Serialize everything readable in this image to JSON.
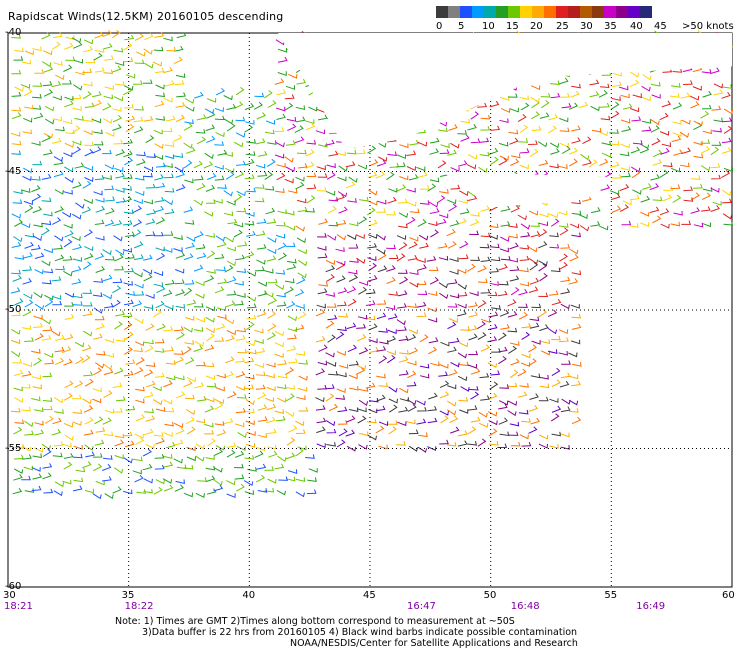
{
  "title": "Rapidscat Winds(12.5KM) 20160105 descending",
  "legend": {
    "colors": [
      "#3c3c3c",
      "#808080",
      "#1e50ff",
      "#009bff",
      "#00aaaa",
      "#23a023",
      "#6cc800",
      "#ffd200",
      "#ffaa00",
      "#ff6f00",
      "#e02020",
      "#b41e1e",
      "#b45a00",
      "#8b3a0f",
      "#c800c8",
      "#8b008b",
      "#6400c8",
      "#282878"
    ],
    "labels": [
      "0",
      "5",
      "10",
      "15",
      "20",
      "25",
      "30",
      "35",
      "40",
      "45",
      ">50 knots"
    ]
  },
  "axes": {
    "lon_ticks": [
      "30",
      "35",
      "40",
      "45",
      "50",
      "55",
      "60"
    ],
    "lat_ticks": [
      "-40",
      "-45",
      "-50",
      "-55",
      "-60"
    ],
    "time_labels": [
      {
        "lon": 30,
        "text": "18:21"
      },
      {
        "lon": 35,
        "text": "18:22"
      },
      {
        "lon": 46.7,
        "text": "16:47"
      },
      {
        "lon": 51,
        "text": "16:48"
      },
      {
        "lon": 56.2,
        "text": "16:49"
      }
    ]
  },
  "notes": [
    "Note: 1) Times are GMT 2)Times along bottom correspond to measurement at ~50S",
    "3)Data buffer is 22 hrs from 20160105 4) Black wind barbs indicate possible contamination",
    "NOAA/NESDIS/Center for Satellite Applications and Research"
  ],
  "wind_regions": [
    {
      "region": "west-north",
      "lon": [
        30,
        37
      ],
      "lat": [
        -40,
        -44
      ],
      "colors": [
        "#ffd200",
        "#ffaa00",
        "#6cc800",
        "#23a023"
      ]
    },
    {
      "region": "west-mid",
      "lon": [
        30,
        37
      ],
      "lat": [
        -44,
        -50
      ],
      "colors": [
        "#1e50ff",
        "#009bff",
        "#00aaaa",
        "#23a023"
      ]
    },
    {
      "region": "center-west",
      "lon": [
        37,
        42
      ],
      "lat": [
        -42,
        -50
      ],
      "colors": [
        "#23a023",
        "#6cc800",
        "#009bff"
      ]
    },
    {
      "region": "south-west",
      "lon": [
        30,
        42
      ],
      "lat": [
        -50,
        -55
      ],
      "colors": [
        "#ffd200",
        "#ffaa00",
        "#ff6f00",
        "#6cc800"
      ]
    },
    {
      "region": "south-far",
      "lon": [
        30,
        42.5
      ],
      "lat": [
        -55,
        -57
      ],
      "colors": [
        "#1e50ff",
        "#23a023",
        "#6cc800"
      ]
    },
    {
      "region": "center-east",
      "lon": [
        42.5,
        53.5
      ],
      "lat": [
        -45,
        -50
      ],
      "colors": [
        "#c800c8",
        "#8b008b",
        "#e02020",
        "#3c3c3c",
        "#ff6f00"
      ]
    },
    {
      "region": "center-south",
      "lon": [
        42.5,
        54
      ],
      "lat": [
        -50,
        -55
      ],
      "colors": [
        "#ffaa00",
        "#ff6f00",
        "#3c3c3c",
        "#8b008b",
        "#6400c8"
      ]
    },
    {
      "region": "east-band",
      "lon": [
        41,
        60
      ],
      "lat": [
        -40,
        -47
      ],
      "colors": [
        "#6cc800",
        "#23a023",
        "#ffd200",
        "#e02020",
        "#ff6f00",
        "#c800c8"
      ]
    }
  ]
}
